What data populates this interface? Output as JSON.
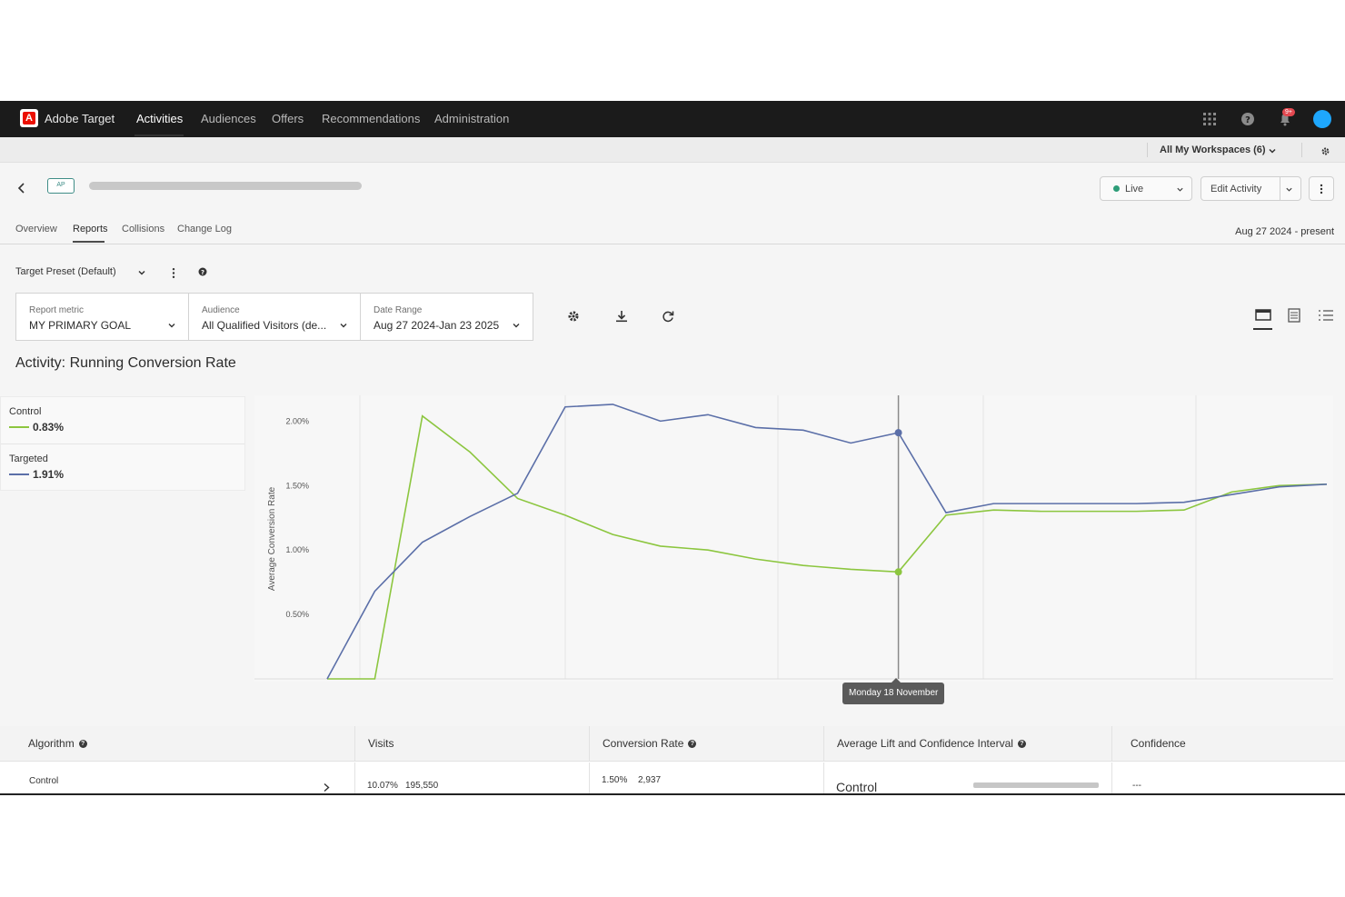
{
  "topnav": {
    "app_name": "Adobe Target",
    "items": [
      {
        "label": "Activities",
        "active": true
      },
      {
        "label": "Audiences"
      },
      {
        "label": "Offers"
      },
      {
        "label": "Recommendations"
      },
      {
        "label": "Administration"
      }
    ],
    "notification_badge": "9+",
    "icons": [
      "apps-grid-icon",
      "help-icon",
      "bell-icon",
      "avatar"
    ]
  },
  "workspace": {
    "label": "All My Workspaces (6)"
  },
  "header": {
    "badge": "AP",
    "status_label": "Live",
    "edit_label": "Edit Activity",
    "date_range": "Aug 27 2024 - present"
  },
  "tabs": [
    {
      "label": "Overview"
    },
    {
      "label": "Reports",
      "active": true
    },
    {
      "label": "Collisions"
    },
    {
      "label": "Change Log"
    }
  ],
  "preset": {
    "label": "Target Preset (Default)"
  },
  "filters": {
    "metric": {
      "label": "Report metric",
      "value": "MY PRIMARY GOAL"
    },
    "audience": {
      "label": "Audience",
      "value": "All Qualified Visitors (de..."
    },
    "date": {
      "label": "Date Range",
      "value": "Aug 27 2024-Jan 23 2025"
    }
  },
  "chart_title": "Activity: Running Conversion Rate",
  "legend": [
    {
      "name": "Control",
      "value": "0.83%",
      "color": "#8cc63f"
    },
    {
      "name": "Targeted",
      "value": "1.91%",
      "color": "#5b6fa8"
    }
  ],
  "tooltip": "Monday 18 November",
  "chart_data": {
    "type": "line",
    "ylabel": "Average Conversion Rate",
    "yticks": [
      "2.00%",
      "1.50%",
      "1.00%",
      "0.50%"
    ],
    "ylim": [
      0,
      2.2
    ],
    "x": [
      0,
      1,
      2,
      3,
      4,
      5,
      6,
      7,
      8,
      9,
      10,
      11,
      12,
      13,
      14,
      15,
      16,
      17,
      18,
      19,
      20,
      21
    ],
    "series": [
      {
        "name": "Control",
        "color": "#8cc63f",
        "values": [
          0.0,
          0.0,
          2.04,
          1.76,
          1.4,
          1.27,
          1.12,
          1.03,
          1.0,
          0.93,
          0.88,
          0.85,
          0.83,
          1.27,
          1.31,
          1.3,
          1.3,
          1.3,
          1.31,
          1.45,
          1.5,
          1.51
        ]
      },
      {
        "name": "Targeted",
        "color": "#5b6fa8",
        "values": [
          0.0,
          0.68,
          1.06,
          1.26,
          1.44,
          2.11,
          2.13,
          2.0,
          2.05,
          1.95,
          1.93,
          1.83,
          1.91,
          1.29,
          1.36,
          1.36,
          1.36,
          1.36,
          1.37,
          1.43,
          1.49,
          1.51
        ]
      }
    ],
    "highlight_index": 12,
    "grid": true
  },
  "table": {
    "headers": [
      "Algorithm",
      "Visits",
      "Conversion Rate",
      "Average Lift and Confidence Interval",
      "Confidence"
    ],
    "rows": [
      {
        "name": "Control",
        "visits_pct": "10.07%",
        "visits": "195,550",
        "conv_rate": "1.50%",
        "conversions": "2,937",
        "lift": "Control",
        "confidence": "---"
      }
    ]
  }
}
